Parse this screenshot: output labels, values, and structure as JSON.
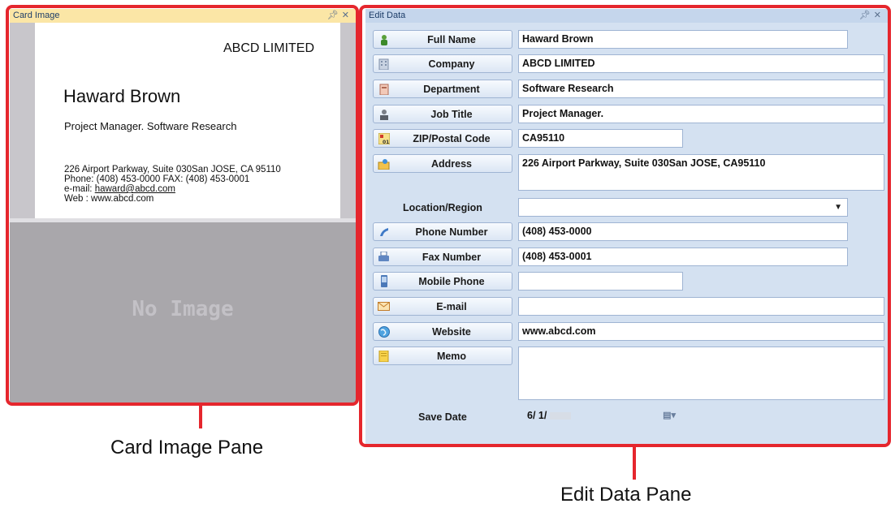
{
  "card_pane": {
    "title": "Card Image",
    "pin_icon": "pin-icon",
    "close_icon": "close-icon",
    "card": {
      "company": "ABCD LIMITED",
      "name": "Haward Brown",
      "title_line": "Project Manager. Software Research",
      "address_line": "226 Airport Parkway, Suite 030San JOSE, CA 95110",
      "phone_line": "Phone: (408) 453-0000      FAX: (408) 453-0001",
      "email_prefix": "e-mail: ",
      "email": "haward@abcd.com",
      "web_line": "Web   : www.abcd.com"
    },
    "no_image": "No Image"
  },
  "edit_pane": {
    "title": "Edit Data",
    "fields": [
      {
        "label": "Full Name",
        "value": "Haward Brown",
        "icon": "person-icon"
      },
      {
        "label": "Company",
        "value": "ABCD LIMITED",
        "icon": "building-icon"
      },
      {
        "label": "Department",
        "value": "Software Research",
        "icon": "department-icon"
      },
      {
        "label": "Job Title",
        "value": "Project Manager.",
        "icon": "job-title-icon"
      },
      {
        "label": "ZIP/Postal Code",
        "value": "CA95110",
        "icon": "zip-icon"
      },
      {
        "label": "Address",
        "value": "226 Airport Parkway, Suite 030San JOSE, CA95110",
        "icon": "address-icon"
      },
      {
        "label": "Location/Region",
        "value": ""
      },
      {
        "label": "Phone Number",
        "value": "(408) 453-0000",
        "icon": "phone-icon"
      },
      {
        "label": "Fax Number",
        "value": "(408) 453-0001",
        "icon": "fax-icon"
      },
      {
        "label": "Mobile Phone",
        "value": "",
        "icon": "mobile-phone-icon"
      },
      {
        "label": "E-mail",
        "value": "",
        "icon": "envelope-icon"
      },
      {
        "label": "Website",
        "value": "www.abcd.com",
        "icon": "globe-icon"
      },
      {
        "label": "Memo",
        "value": "",
        "icon": "memo-icon"
      },
      {
        "label": "Save Date",
        "value": "6/  1/"
      }
    ]
  },
  "captions": {
    "card_image_pane": "Card Image Pane",
    "edit_data_pane": "Edit Data Pane"
  },
  "colors": {
    "callout": "#e5262d",
    "card_title_bar": "#fbe6a6",
    "edit_pane_bg": "#d4e1f1"
  }
}
